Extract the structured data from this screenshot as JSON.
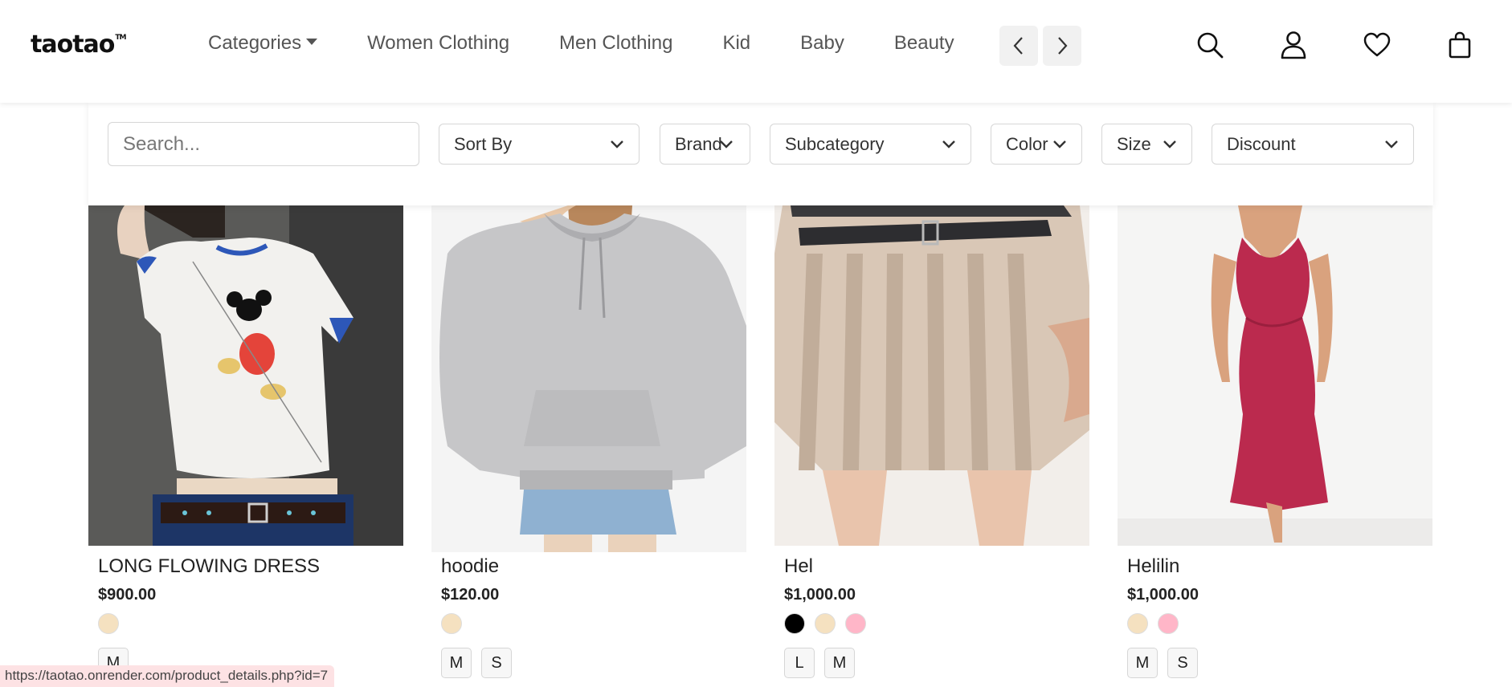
{
  "brand": {
    "logo_text": "taotao",
    "trademark": "TM"
  },
  "nav": {
    "items": [
      {
        "label": "Categories",
        "dropdown": true
      },
      {
        "label": "Women Clothing"
      },
      {
        "label": "Men Clothing"
      },
      {
        "label": "Kid"
      },
      {
        "label": "Baby"
      },
      {
        "label": "Beauty"
      }
    ],
    "prev_icon": "chevron-left-icon",
    "next_icon": "chevron-right-icon"
  },
  "header_icons": [
    "search-icon",
    "user-icon",
    "heart-icon",
    "shopping-bag-icon"
  ],
  "filters": {
    "search_placeholder": "Search...",
    "selects": [
      {
        "label": "Sort By"
      },
      {
        "label": "Brand"
      },
      {
        "label": "Subcategory"
      },
      {
        "label": "Color"
      },
      {
        "label": "Size"
      },
      {
        "label": "Discount"
      }
    ]
  },
  "products": [
    {
      "name": "LONG FLOWING DRESS",
      "price": "$900.00",
      "colors": [
        "#f5e1c0"
      ],
      "sizes": [
        "M"
      ]
    },
    {
      "name": "hoodie",
      "price": "$120.00",
      "colors": [
        "#f5e1c0"
      ],
      "sizes": [
        "M",
        "S"
      ]
    },
    {
      "name": "Hel",
      "price": "$1,000.00",
      "colors": [
        "#000000",
        "#f5e1c0",
        "#ffb6c8"
      ],
      "sizes": [
        "L",
        "M"
      ]
    },
    {
      "name": "Helilin",
      "price": "$1,000.00",
      "colors": [
        "#f5e1c0",
        "#ffb6c8"
      ],
      "sizes": [
        "M",
        "S"
      ]
    }
  ],
  "status_bar": {
    "url": "https://taotao.onrender.com/product_details.php?id=7"
  }
}
